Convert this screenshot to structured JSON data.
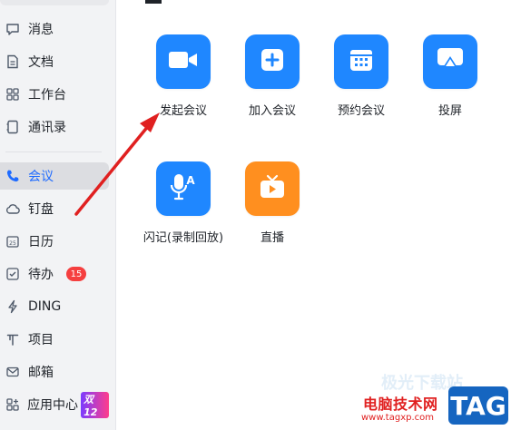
{
  "sidebar": {
    "items": [
      {
        "label": "消息",
        "icon": "chat-bubble-icon"
      },
      {
        "label": "文档",
        "icon": "document-icon"
      },
      {
        "label": "工作台",
        "icon": "grid-icon"
      },
      {
        "label": "通讯录",
        "icon": "contacts-icon"
      },
      {
        "label": "会议",
        "icon": "phone-icon",
        "active": true
      },
      {
        "label": "钉盘",
        "icon": "cloud-icon"
      },
      {
        "label": "日历",
        "icon": "calendar-icon"
      },
      {
        "label": "待办",
        "icon": "checkbox-icon",
        "badge": "15"
      },
      {
        "label": "DING",
        "icon": "lightning-icon"
      },
      {
        "label": "项目",
        "icon": "project-icon"
      },
      {
        "label": "邮箱",
        "icon": "mail-icon"
      },
      {
        "label": "应用中心",
        "icon": "apps-icon",
        "tag": "双12"
      }
    ]
  },
  "tiles": [
    {
      "label": "发起会议",
      "icon": "video-camera-icon",
      "color": "#1f87ff"
    },
    {
      "label": "加入会议",
      "icon": "plus-icon",
      "color": "#1f87ff"
    },
    {
      "label": "预约会议",
      "icon": "calendar-icon",
      "color": "#1f87ff"
    },
    {
      "label": "投屏",
      "icon": "screen-cast-icon",
      "color": "#1f87ff"
    },
    {
      "label": "闪记(录制回放)",
      "icon": "mic-a-icon",
      "color": "#1f87ff"
    },
    {
      "label": "直播",
      "icon": "tv-play-icon",
      "color": "#ff8f1f"
    }
  ],
  "watermark": {
    "line1": "电脑技术网",
    "line2": "www.tagxp.com",
    "tag": "TAG",
    "faded": "极光下载站"
  },
  "colors": {
    "accent": "#1f6bff",
    "annotation": "#e02020"
  }
}
